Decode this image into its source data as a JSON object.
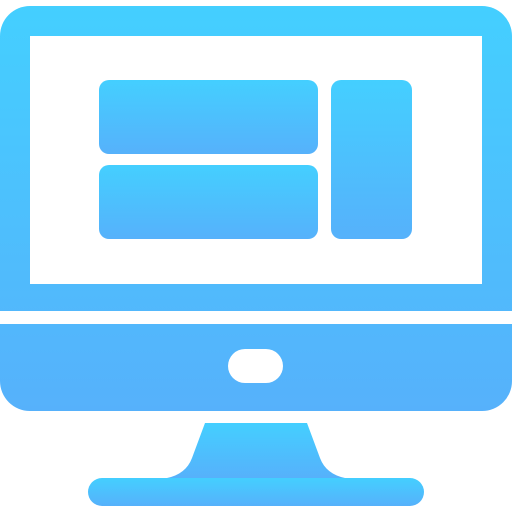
{
  "icon": {
    "name": "desktop-computer-icon",
    "colors": {
      "gradient_top": "#44CFFF",
      "gradient_bottom": "#56B1FB",
      "background": "#FFFFFF"
    },
    "screen_content": "dashboard-layout-icon"
  }
}
